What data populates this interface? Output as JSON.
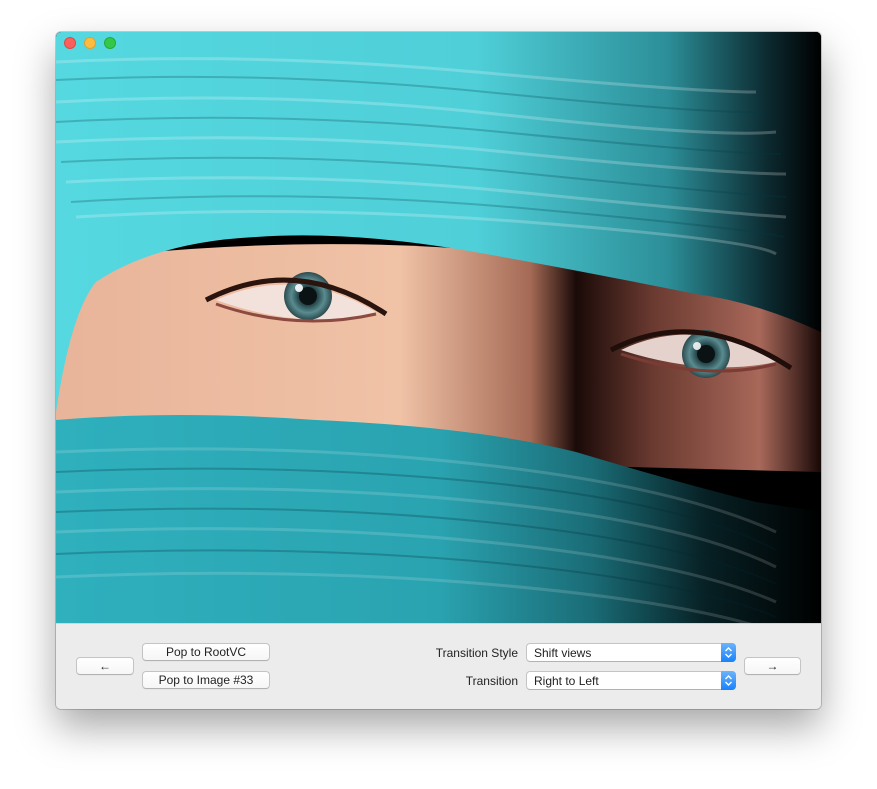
{
  "window": {
    "traffic_lights": [
      "close",
      "minimize",
      "zoom"
    ]
  },
  "image": {
    "icon": "photo-of-eyes-with-turquoise-scarf"
  },
  "toolbar": {
    "back_label": "←",
    "forward_label": "→",
    "pop_root_label": "Pop to RootVC",
    "pop_image_label": "Pop to Image #33",
    "transition_style_label": "Transition Style",
    "transition_style_value": "Shift views",
    "transition_label": "Transition",
    "transition_value": "Right to Left"
  },
  "colors": {
    "accent": "#1a82fb",
    "scarf_top": "#4fd3dc",
    "scarf_bottom": "#2aa5b2",
    "close": "#fc605c",
    "minimize": "#fdbc40",
    "zoom": "#34c84a"
  }
}
